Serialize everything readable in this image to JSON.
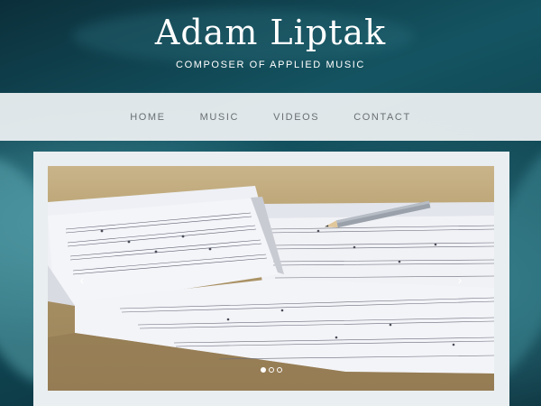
{
  "site": {
    "title": "Adam Liptak",
    "subtitle": "COMPOSER OF APPLIED MUSIC"
  },
  "nav": {
    "items": [
      {
        "label": "HOME"
      },
      {
        "label": "MUSIC"
      },
      {
        "label": "VIDEOS"
      },
      {
        "label": "CONTACT"
      }
    ]
  },
  "slider": {
    "prev_icon": "chevron-left-icon",
    "next_icon": "chevron-right-icon",
    "prev_glyph": "‹",
    "next_glyph": "›",
    "slide_count": 3,
    "active_index": 0,
    "image_description": "sheet music with pencil"
  },
  "colors": {
    "nav_background": "#eceff2",
    "nav_text": "#6a6f73",
    "title_text": "#ffffff",
    "frame_background": "#e9eef0"
  }
}
